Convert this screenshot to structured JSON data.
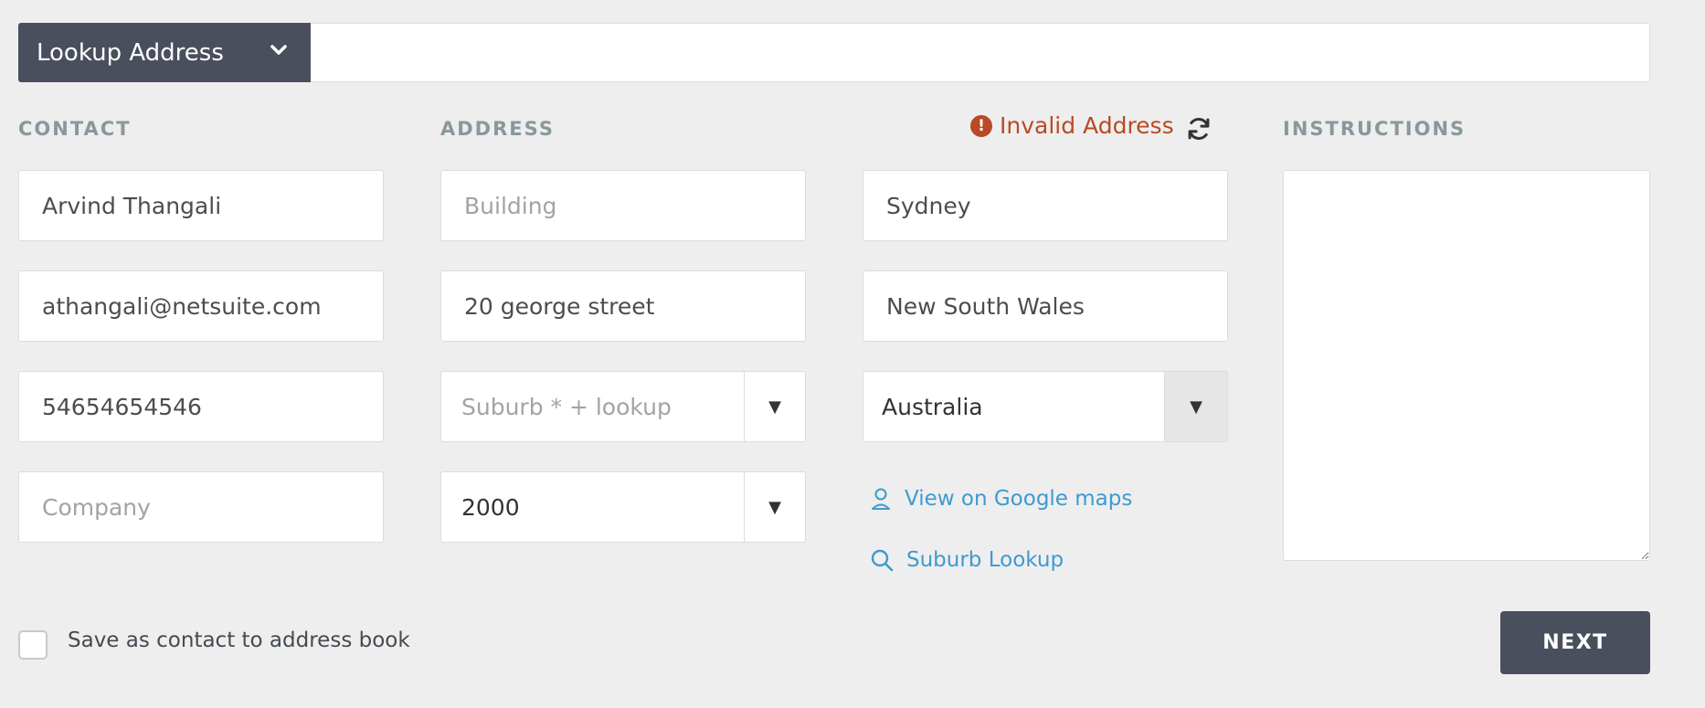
{
  "lookup": {
    "button_label": "Lookup Address",
    "search_value": ""
  },
  "contact": {
    "heading": "CONTACT",
    "name": "Arvind Thangali",
    "email": "athangali@netsuite.com",
    "phone": "54654654546",
    "company_placeholder": "Company"
  },
  "address": {
    "heading": "ADDRESS",
    "building_placeholder": "Building",
    "street": "20 george street",
    "suburb_placeholder": "Suburb * + lookup",
    "postcode": "2000",
    "city": "Sydney",
    "state": "New South Wales",
    "country": "Australia",
    "status": "Invalid Address"
  },
  "links": {
    "maps": "View on Google maps",
    "suburb_lookup": "Suburb Lookup"
  },
  "instructions": {
    "heading": "INSTRUCTIONS",
    "value": ""
  },
  "footer": {
    "save_label": "Save as contact to address book",
    "next_label": "NEXT"
  },
  "colors": {
    "dark_button": "#4a4f5d",
    "error": "#b84a25",
    "link": "#3e9ad0",
    "heading": "#8a979c"
  },
  "icons": {
    "lookup_toggle": "chevron-down-icon",
    "status": "exclamation-circle-icon",
    "refresh": "refresh-icon",
    "maps": "person-pin-icon",
    "suburb_lookup": "search-icon",
    "select_arrow": "triangle-down-icon"
  }
}
